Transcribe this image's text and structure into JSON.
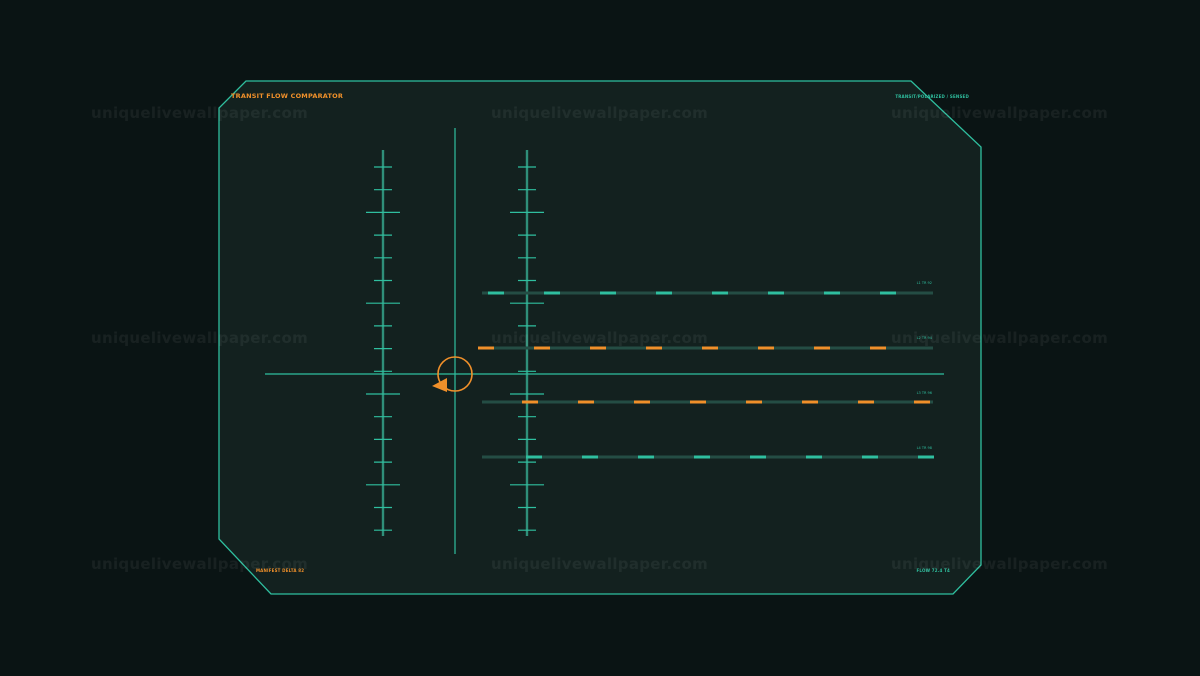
{
  "panel": {
    "title": "TRANSIT FLOW COMPARATOR",
    "mode_label": "TRANSIT/POLARIZED / SENSED",
    "manifest_label": "MANIFEST DELTA 82",
    "flow_label": "FLOW 72.4 T4"
  },
  "lanes": [
    {
      "label": "L1 TR 92",
      "color": "#2fbf9f"
    },
    {
      "label": "L2 TR 94",
      "color": "#f0902a"
    },
    {
      "label": "L3 TR 96",
      "color": "#f0902a"
    },
    {
      "label": "L4 TR 98",
      "color": "#2fbf9f"
    }
  ],
  "watermark": {
    "text": "uniquelivewallpaper.com"
  },
  "colors": {
    "background": "#0a1414",
    "panel_fill": "#13211f",
    "accent_teal": "#2fbf9f",
    "accent_orange": "#f0902a",
    "track_dim": "#244d44"
  }
}
